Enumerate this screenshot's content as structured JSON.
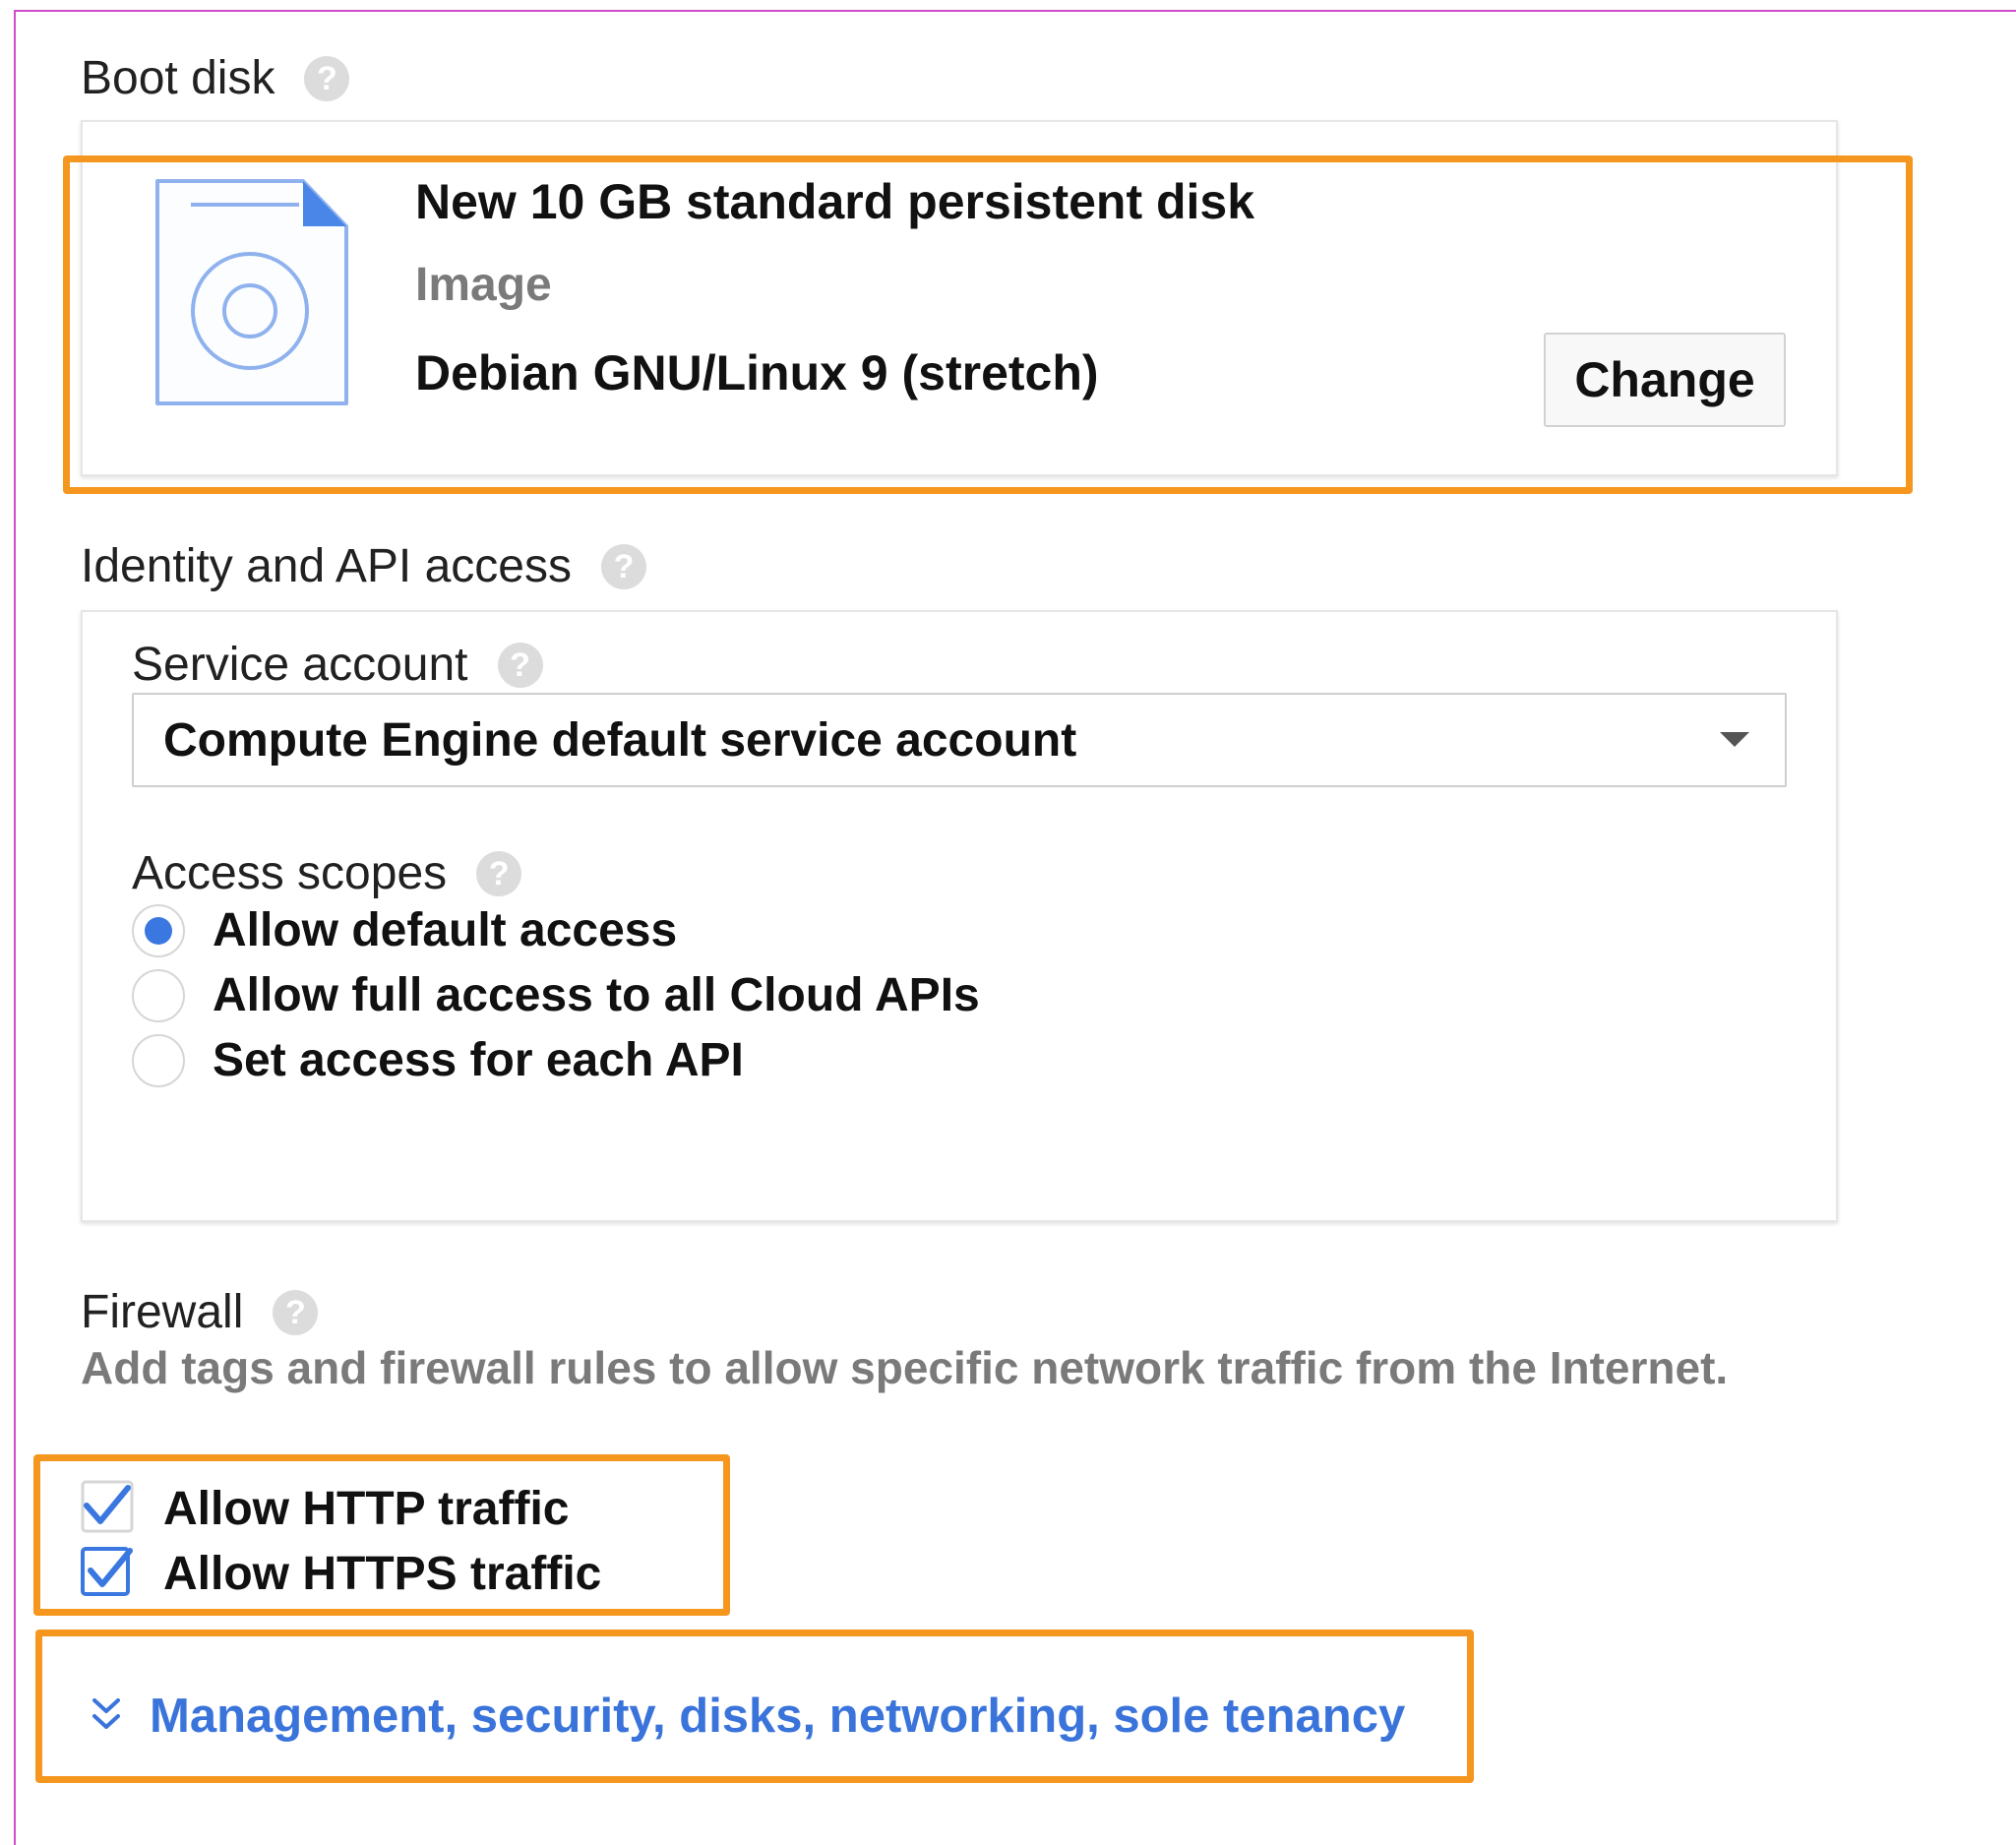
{
  "boot_disk": {
    "title": "Boot disk",
    "help_glyph": "?",
    "disk_label": "New 10 GB standard persistent disk",
    "image_label": "Image",
    "image_value": "Debian GNU/Linux 9 (stretch)",
    "change_button": "Change",
    "icon": "disk-file-icon"
  },
  "identity": {
    "title": "Identity and API access",
    "service_account": {
      "label": "Service account",
      "selected": "Compute Engine default service account"
    },
    "access_scopes": {
      "label": "Access scopes",
      "options": [
        {
          "label": "Allow default access",
          "selected": true
        },
        {
          "label": "Allow full access to all Cloud APIs",
          "selected": false
        },
        {
          "label": "Set access for each API",
          "selected": false
        }
      ]
    }
  },
  "firewall": {
    "title": "Firewall",
    "description": "Add tags and firewall rules to allow specific network traffic from the Internet.",
    "options": [
      {
        "label": "Allow HTTP traffic",
        "checked": true
      },
      {
        "label": "Allow HTTPS traffic",
        "checked": true
      }
    ]
  },
  "more_link": {
    "text": "Management, security, disks, networking, sole tenancy",
    "icon": "double-chevron-down-icon"
  },
  "colors": {
    "highlight": "#f5961e",
    "accent_blue": "#3b77e0",
    "link_blue": "#3a74db",
    "frame_magenta": "#d04dc8"
  }
}
